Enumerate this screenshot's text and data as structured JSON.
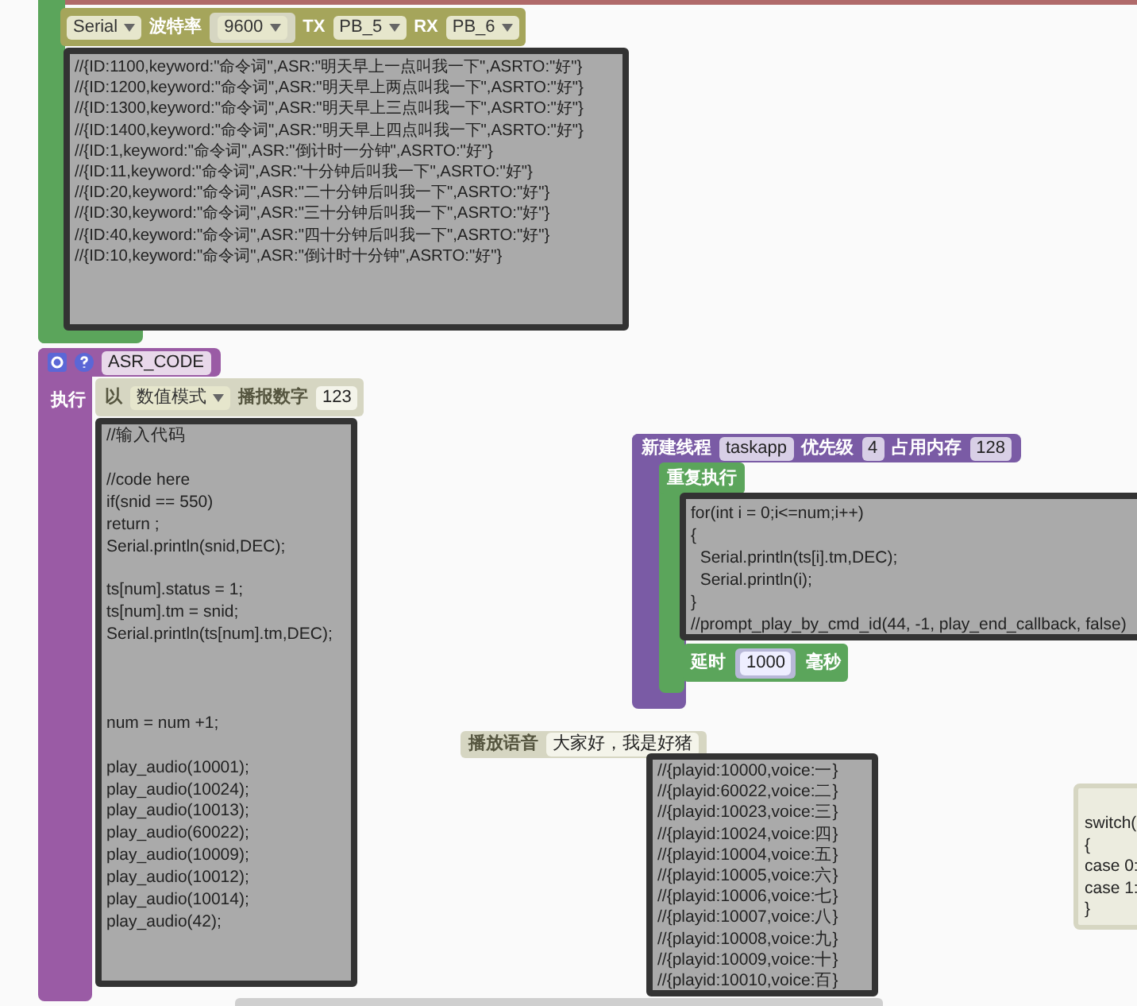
{
  "serial_block": {
    "port": "Serial",
    "baud_label": "波特率",
    "baud": "9600",
    "tx_label": "TX",
    "tx": "PB_5",
    "rx_label": "RX",
    "rx": "PB_6"
  },
  "comment_block": {
    "code": "//{ID:1100,keyword:\"命令词\",ASR:\"明天早上一点叫我一下\",ASRTO:\"好\"}\n//{ID:1200,keyword:\"命令词\",ASR:\"明天早上两点叫我一下\",ASRTO:\"好\"}\n//{ID:1300,keyword:\"命令词\",ASR:\"明天早上三点叫我一下\",ASRTO:\"好\"}\n//{ID:1400,keyword:\"命令词\",ASR:\"明天早上四点叫我一下\",ASRTO:\"好\"}\n//{ID:1,keyword:\"命令词\",ASR:\"倒计时一分钟\",ASRTO:\"好\"}\n//{ID:11,keyword:\"命令词\",ASR:\"十分钟后叫我一下\",ASRTO:\"好\"}\n//{ID:20,keyword:\"命令词\",ASR:\"二十分钟后叫我一下\",ASRTO:\"好\"}\n//{ID:30,keyword:\"命令词\",ASR:\"三十分钟后叫我一下\",ASRTO:\"好\"}\n//{ID:40,keyword:\"命令词\",ASR:\"四十分钟后叫我一下\",ASRTO:\"好\"}\n//{ID:10,keyword:\"命令词\",ASR:\"倒计时十分钟\",ASRTO:\"好\"}"
  },
  "asr_block": {
    "name": "ASR_CODE",
    "exec_label": "执行",
    "speak_block": {
      "prefix": "以",
      "mode": "数值模式",
      "label": "播报数字",
      "number": "123"
    },
    "code": "//输入代码\n\n//code here\nif(snid == 550)\nreturn ;\nSerial.println(snid,DEC);\n\nts[num].status = 1;\nts[num].tm = snid;\nSerial.println(ts[num].tm,DEC);\n\n\n\nnum = num +1;\n\nplay_audio(10001);\nplay_audio(10024);\nplay_audio(10013);\nplay_audio(60022);\nplay_audio(10009);\nplay_audio(10012);\nplay_audio(10014);\nplay_audio(42);"
  },
  "thread_block": {
    "label": "新建线程",
    "name": "taskapp",
    "priority_label": "优先级",
    "priority": "4",
    "memory_label": "占用内存",
    "memory": "128",
    "loop_label": "重复执行",
    "code": "for(int i = 0;i<=num;i++)\n{\n  Serial.println(ts[i].tm,DEC);\n  Serial.println(i);\n}\n//prompt_play_by_cmd_id(44, -1, play_end_callback, false)",
    "delay": {
      "label": "延时",
      "value": "1000",
      "unit": "毫秒"
    }
  },
  "voice_block": {
    "label": "播放语音",
    "text": "大家好，我是好猪",
    "code": "//{playid:10000,voice:一}\n//{playid:60022,voice:二}\n//{playid:10023,voice:三}\n//{playid:10024,voice:四}\n//{playid:10004,voice:五}\n//{playid:10005,voice:六}\n//{playid:10006,voice:七}\n//{playid:10007,voice:八}\n//{playid:10008,voice:九}\n//{playid:10009,voice:十}\n//{playid:10010,voice:百}"
  },
  "switch_block": {
    "code": "switch(\n{\ncase 0:\ncase 1:\n}"
  }
}
